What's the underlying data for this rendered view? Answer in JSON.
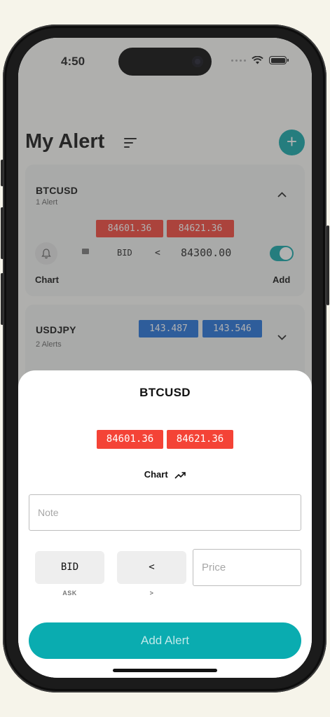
{
  "status": {
    "time": "4:50"
  },
  "header": {
    "title": "My Alert"
  },
  "alerts": [
    {
      "symbol": "BTCUSD",
      "count_label": "1 Alert",
      "bid": "84601.36",
      "ask": "84621.36",
      "alert": {
        "side": "BID",
        "operator": "<",
        "price": "84300.00",
        "enabled": true
      },
      "chart_label": "Chart",
      "add_label": "Add"
    },
    {
      "symbol": "USDJPY",
      "count_label": "2 Alerts",
      "bid": "143.487",
      "ask": "143.546"
    }
  ],
  "sheet": {
    "title": "BTCUSD",
    "bid": "84601.36",
    "ask": "84621.36",
    "chart_label": "Chart",
    "note_placeholder": "Note",
    "side_button": "BID",
    "side_alt": "ASK",
    "operator_button": "<",
    "operator_alt": ">",
    "price_placeholder": "Price",
    "submit_label": "Add Alert"
  },
  "colors": {
    "accent": "#0ea5a8",
    "bid_red": "#f44336",
    "ask_blue": "#1e6fd9"
  }
}
